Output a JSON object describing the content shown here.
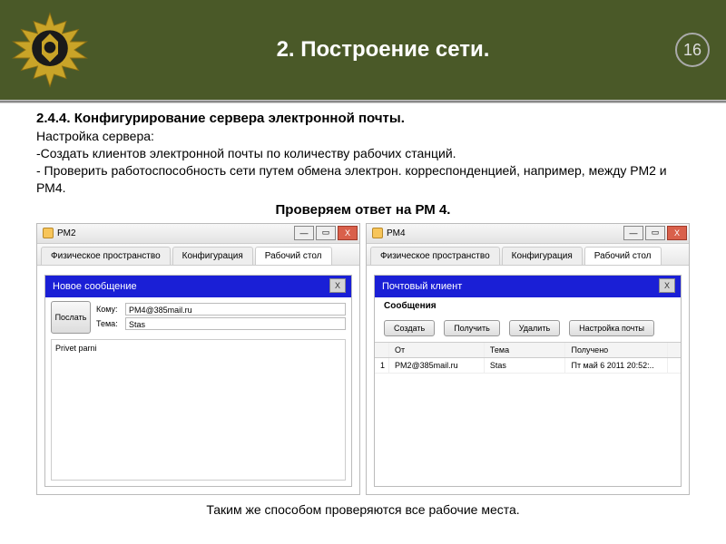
{
  "header": {
    "title": "2.  Построение сети.",
    "page": "16"
  },
  "section": {
    "heading": "2.4.4. Конфигурирование сервера электронной почты.",
    "l1": "Настройка  сервера:",
    "l2": "-Создать клиентов электронной почты по количеству рабочих станций.",
    "l3": "- Проверить работоспособность сети путем обмена электрон. корреспонденцией, например, между РМ2 и РМ4.",
    "check_caption": "Проверяем ответ на РМ 4."
  },
  "left": {
    "title": "PM2",
    "tabs": {
      "t1": "Физическое пространство",
      "t2": "Конфигурация",
      "t3": "Рабочий стол"
    },
    "panel_title": "Новое сообщение",
    "send": "Послать",
    "to_lbl": "Кому:",
    "to_val": "PM4@385mail.ru",
    "subj_lbl": "Тема:",
    "subj_val": "Stas",
    "body": "Privet parni",
    "x": "X"
  },
  "right": {
    "title": "PM4",
    "tabs": {
      "t1": "Физическое пространство",
      "t2": "Конфигурация",
      "t3": "Рабочий стол"
    },
    "panel_title": "Почтовый клиент",
    "messages_lbl": "Сообщения",
    "btn_create": "Создать",
    "btn_get": "Получить",
    "btn_del": "Удалить",
    "btn_cfg": "Настройка почты",
    "col_from": "От",
    "col_subj": "Тема",
    "col_recv": "Получено",
    "row": {
      "n": "1",
      "from": "PM2@385mail.ru",
      "subj": "Stas",
      "recv": "Пт май 6 2011 20:52:.."
    },
    "x": "X"
  },
  "footer": "Таким же способом проверяются все рабочие места.",
  "winicons": {
    "min": "—",
    "max": "▭",
    "close": "X"
  }
}
